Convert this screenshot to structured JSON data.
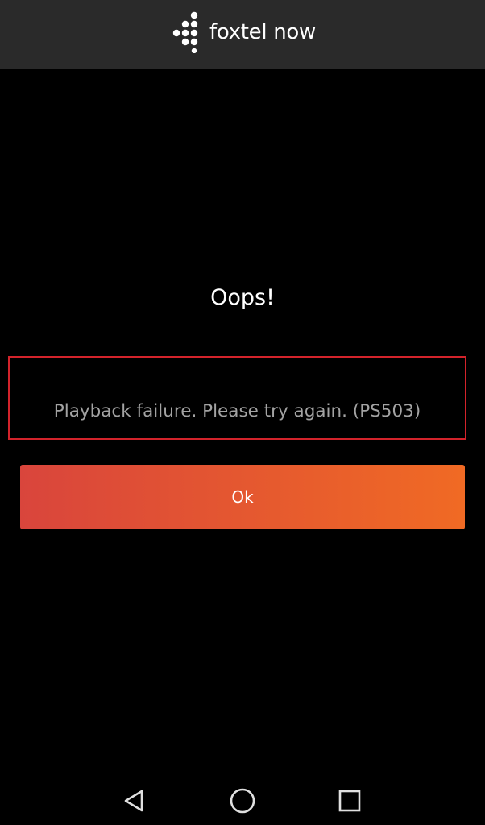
{
  "header": {
    "logo_text": "foxtel now",
    "logo_icon": "foxtel-dots-logo"
  },
  "dialog": {
    "title": "Oops!",
    "message": "Playback failure. Please try again. (PS503)",
    "ok_label": "Ok"
  },
  "colors": {
    "header_bg": "#2a2a2a",
    "background": "#000000",
    "error_border": "#d3232b",
    "button_gradient_start": "#d9453c",
    "button_gradient_end": "#f06a24",
    "message_text": "#a3a3a3"
  },
  "nav_bar": {
    "icons": [
      "back-triangle-icon",
      "home-circle-icon",
      "recent-apps-square-icon"
    ]
  }
}
